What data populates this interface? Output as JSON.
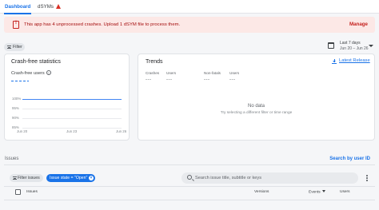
{
  "tabs": [
    {
      "label": "Dashboard",
      "active": true
    },
    {
      "label": "dSYMs",
      "active": false,
      "icon": "warning-triangle-icon"
    }
  ],
  "banner": {
    "icon": "error-document-icon",
    "message": "This app has 4 unprocessed crashes. Upload 1 dSYM file to process them.",
    "action": "Manage",
    "color": "#fce8e6",
    "text_color": "#a50e0e"
  },
  "toolbar": {
    "filter_label": "Filter",
    "date_label": "Last 7 days",
    "date_range": "Jun 20 – Jun 26"
  },
  "crash_free": {
    "title": "Crash-free statistics",
    "subtitle": "Crash-free users",
    "chart_data": {
      "type": "line",
      "x_ticks": [
        "Jun 20",
        "Jun 23",
        "Jun 26"
      ],
      "y_ticks": [
        "100%",
        "95%",
        "90%",
        "85%"
      ],
      "ylim": [
        85,
        100
      ],
      "series": [
        {
          "x": [
            "Jun 20",
            "Jun 26"
          ],
          "y": [
            100,
            100
          ]
        }
      ],
      "series_color": "#4285f4"
    }
  },
  "trends": {
    "title": "Trends",
    "latest_release": "Latest Release",
    "columns": [
      {
        "label": "Crashes",
        "value": "---"
      },
      {
        "label": "Users",
        "value": "---"
      },
      {
        "label": "Non-fatals",
        "value": "---"
      },
      {
        "label": "Users",
        "value": "---"
      }
    ],
    "no_data": "No data",
    "no_data_hint": "Try selecting a different filter or time range"
  },
  "issues": {
    "heading": "Issues",
    "search_by_user": "Search by user ID",
    "filter_chip": "Filter issues",
    "state_chip": "Issue state = \"Open\"",
    "search_placeholder": "Search issue title, subtitle or keys",
    "columns": [
      "Issues",
      "Versions",
      "Events",
      "Users"
    ]
  },
  "accent": "#1a73e8"
}
